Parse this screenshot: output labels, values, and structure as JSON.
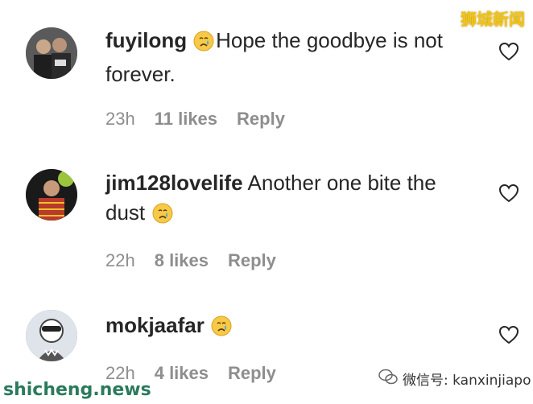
{
  "watermarks": {
    "top_right": "狮城新闻",
    "bottom_left": "shicheng.news",
    "bottom_right": "微信号: kanxinjiapo"
  },
  "comments": [
    {
      "username": "fuyilong",
      "emoji": "crying-face-emoji",
      "text": "Hope the goodbye is not forever.",
      "time": "23h",
      "likes": "11 likes",
      "reply": "Reply"
    },
    {
      "username": "jim128lovelife",
      "emoji_after_text": "crying-face-emoji",
      "text": "Another one bite the dust",
      "time": "22h",
      "likes": "8 likes",
      "reply": "Reply"
    },
    {
      "username": "mokjaafar",
      "emoji_after_username": "crying-face-emoji",
      "text": "",
      "time": "22h",
      "likes": "4 likes",
      "reply": "Reply"
    }
  ],
  "icons": {
    "like": "heart-outline-icon"
  },
  "colors": {
    "text": "#262626",
    "meta": "#8e8e8e"
  }
}
